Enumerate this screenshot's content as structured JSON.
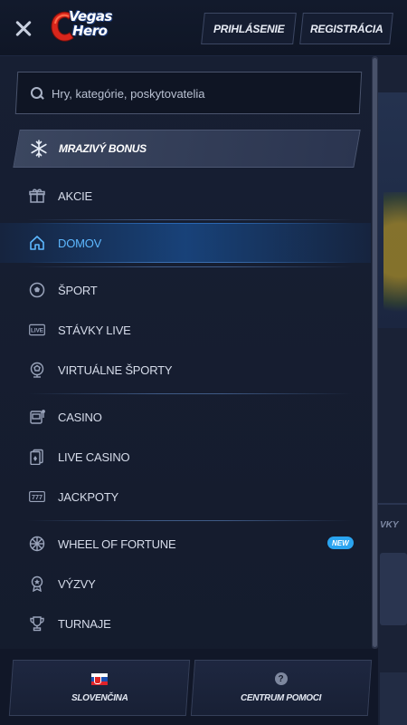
{
  "header": {
    "logo_line1": "Vegas",
    "logo_line2": "Hero",
    "login_label": "PRIHLÁSENIE",
    "register_label": "REGISTRÁCIA"
  },
  "search": {
    "placeholder": "Hry, kategórie, poskytovatelia",
    "value": ""
  },
  "bonus": {
    "label": "MRAZIVÝ BONUS"
  },
  "menu": {
    "groups": [
      [
        {
          "label": "AKCIE",
          "icon": "gift-icon"
        }
      ],
      [
        {
          "label": "DOMOV",
          "icon": "home-icon",
          "active": true
        }
      ],
      [
        {
          "label": "ŠPORT",
          "icon": "soccer-ball-icon"
        },
        {
          "label": "STÁVKY LIVE",
          "icon": "live-icon"
        },
        {
          "label": "VIRTUÁLNE ŠPORTY",
          "icon": "virtual-sports-icon"
        }
      ],
      [
        {
          "label": "CASINO",
          "icon": "slot-machine-icon"
        },
        {
          "label": "LIVE CASINO",
          "icon": "cards-icon"
        },
        {
          "label": "JACKPOTY",
          "icon": "jackpot-777-icon"
        }
      ],
      [
        {
          "label": "WHEEL OF FORTUNE",
          "icon": "wheel-icon",
          "badge": "NEW"
        },
        {
          "label": "VÝZVY",
          "icon": "medal-icon"
        },
        {
          "label": "TURNAJE",
          "icon": "trophy-icon"
        }
      ]
    ]
  },
  "footer": {
    "language_label": "SLOVENČINA",
    "help_label": "CENTRUM POMOCI",
    "help_icon_glyph": "?"
  },
  "background": {
    "cut_text": "VKY"
  },
  "colors": {
    "accent": "#5db8ff",
    "badge": "#2aa4f0"
  }
}
